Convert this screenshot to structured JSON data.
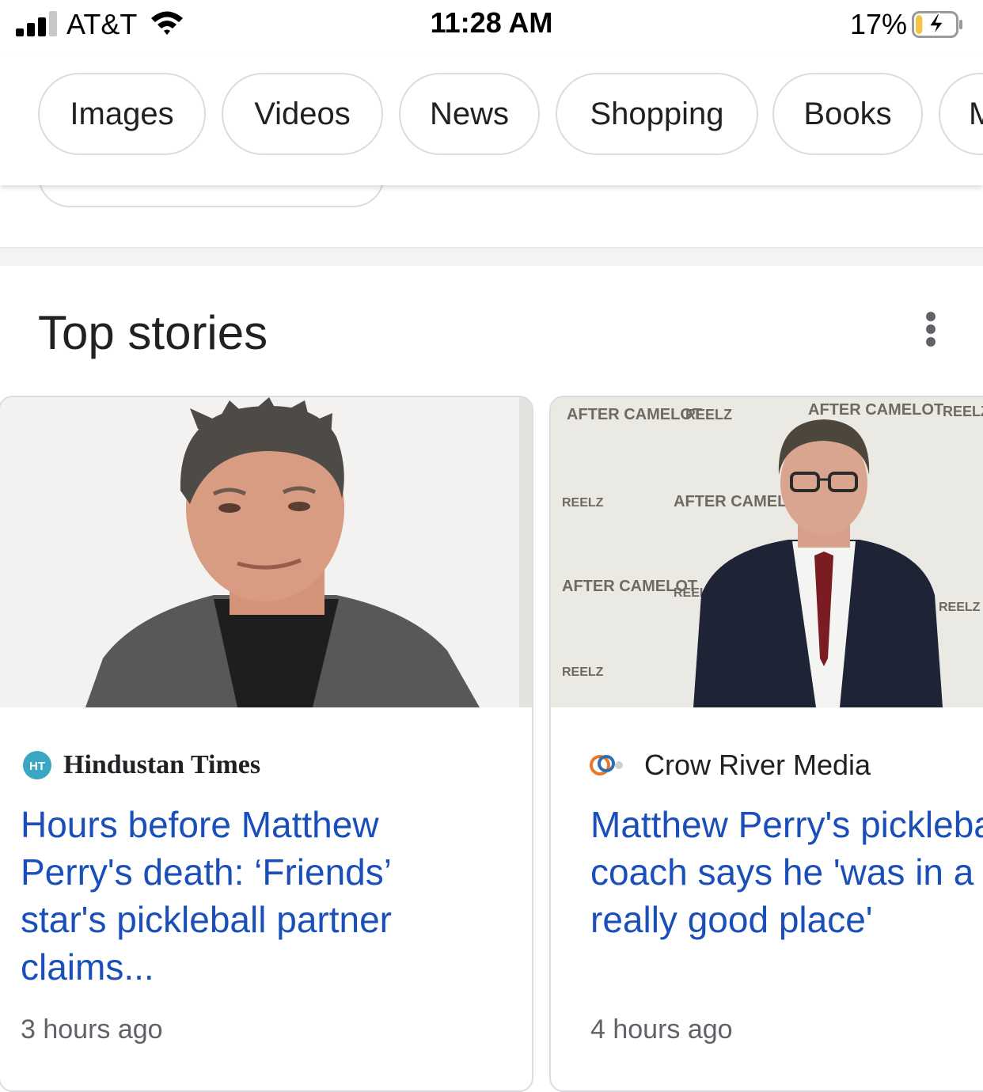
{
  "status_bar": {
    "carrier": "AT&T",
    "time": "11:28 AM",
    "battery_percent": "17%",
    "battery_level": 0.17,
    "charging": true
  },
  "chips": [
    "Images",
    "Videos",
    "News",
    "Shopping",
    "Books",
    "M"
  ],
  "top_stories": {
    "title": "Top stories",
    "cards": [
      {
        "source": "Hindustan Times",
        "source_badge": "HT",
        "headline": "Hours before Matthew Perry's death: ‘Friends’ star's pickleball partner claims...",
        "age": "3 hours ago"
      },
      {
        "source": "Crow River Media",
        "headline": "Matthew Perry's pickleball coach says he 'was in a really good place'",
        "age": "4 hours ago",
        "backdrop_text": [
          "AFTER CAMELOT",
          "REELZ"
        ]
      }
    ]
  },
  "colors": {
    "link_blue": "#1a4fba",
    "chip_border": "#dadce0",
    "meta_gray": "#5f6368"
  },
  "icons": [
    "cellular-signal-icon",
    "wifi-icon",
    "battery-charging-icon",
    "more-vert-icon",
    "source-logo-icon"
  ]
}
